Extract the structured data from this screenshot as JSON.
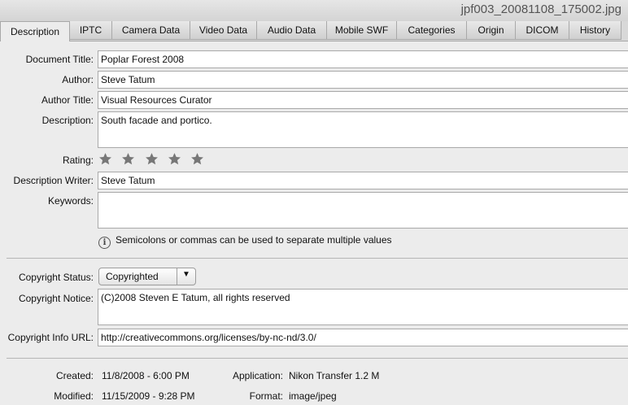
{
  "window": {
    "filename": "jpf003_20081108_175002.jpg"
  },
  "tabs": [
    {
      "label": "Description"
    },
    {
      "label": "IPTC"
    },
    {
      "label": "Camera Data"
    },
    {
      "label": "Video Data"
    },
    {
      "label": "Audio Data"
    },
    {
      "label": "Mobile SWF"
    },
    {
      "label": "Categories"
    },
    {
      "label": "Origin"
    },
    {
      "label": "DICOM"
    },
    {
      "label": "History"
    }
  ],
  "fields": {
    "document_title": {
      "label": "Document Title:",
      "value": "Poplar Forest 2008"
    },
    "author": {
      "label": "Author:",
      "value": "Steve Tatum"
    },
    "author_title": {
      "label": "Author Title:",
      "value": "Visual Resources Curator"
    },
    "description": {
      "label": "Description:",
      "value": "South facade and portico."
    },
    "rating": {
      "label": "Rating:",
      "stars": 5,
      "filled": 0
    },
    "description_writer": {
      "label": "Description Writer:",
      "value": "Steve Tatum"
    },
    "keywords": {
      "label": "Keywords:",
      "value": ""
    },
    "keywords_hint": "Semicolons or commas can be used to separate multiple values",
    "copyright_status": {
      "label": "Copyright Status:",
      "value": "Copyrighted"
    },
    "copyright_notice": {
      "label": "Copyright Notice:",
      "value": "(C)2008 Steven E Tatum, all rights reserved"
    },
    "copyright_url": {
      "label": "Copyright Info URL:",
      "value": "http://creativecommons.org/licenses/by-nc-nd/3.0/"
    }
  },
  "file_info": {
    "created_label": "Created:",
    "created": "11/8/2008 - 6:00 PM",
    "modified_label": "Modified:",
    "modified": "11/15/2009 - 9:28 PM",
    "application_label": "Application:",
    "application": "Nikon Transfer 1.2 M",
    "format_label": "Format:",
    "format": "image/jpeg"
  },
  "colors": {
    "star": "#777777",
    "field_border": "#a9a9a9",
    "background": "#ececec"
  },
  "icons": {
    "dropdown": "chevron-down-icon",
    "hint": "info-icon",
    "rating": "star-icon"
  }
}
